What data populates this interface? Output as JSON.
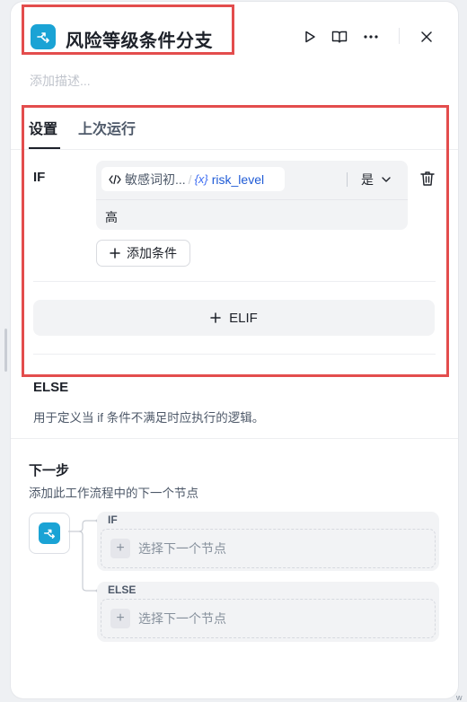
{
  "header": {
    "title": "风险等级条件分支",
    "description_placeholder": "添加描述..."
  },
  "tabs": [
    {
      "label": "设置",
      "active": true
    },
    {
      "label": "上次运行",
      "active": false
    }
  ],
  "if_section": {
    "label": "IF",
    "condition": {
      "source_node": "敏感词初...",
      "separator": "/",
      "variable_badge": "{x}",
      "variable": "risk_level",
      "operator": "是",
      "value": "高"
    },
    "add_condition_label": "添加条件",
    "elif_label": "ELIF"
  },
  "else_section": {
    "title": "ELSE",
    "description": "用于定义当 if 条件不满足时应执行的逻辑。"
  },
  "next_step": {
    "title": "下一步",
    "description": "添加此工作流程中的下一个节点",
    "branches": [
      {
        "label": "IF",
        "placeholder": "选择下一个节点"
      },
      {
        "label": "ELSE",
        "placeholder": "选择下一个节点"
      }
    ]
  },
  "edge_mark": "w",
  "colors": {
    "accent": "#1aa3d5",
    "variable": "#1f5bd6",
    "highlight_box": "#e34d4d",
    "muted_bg": "#f2f3f5"
  },
  "icons": [
    "branch-icon",
    "play-icon",
    "book-icon",
    "more-icon",
    "close-icon",
    "code-icon",
    "chevron-down-icon",
    "trash-icon",
    "plus-icon"
  ]
}
